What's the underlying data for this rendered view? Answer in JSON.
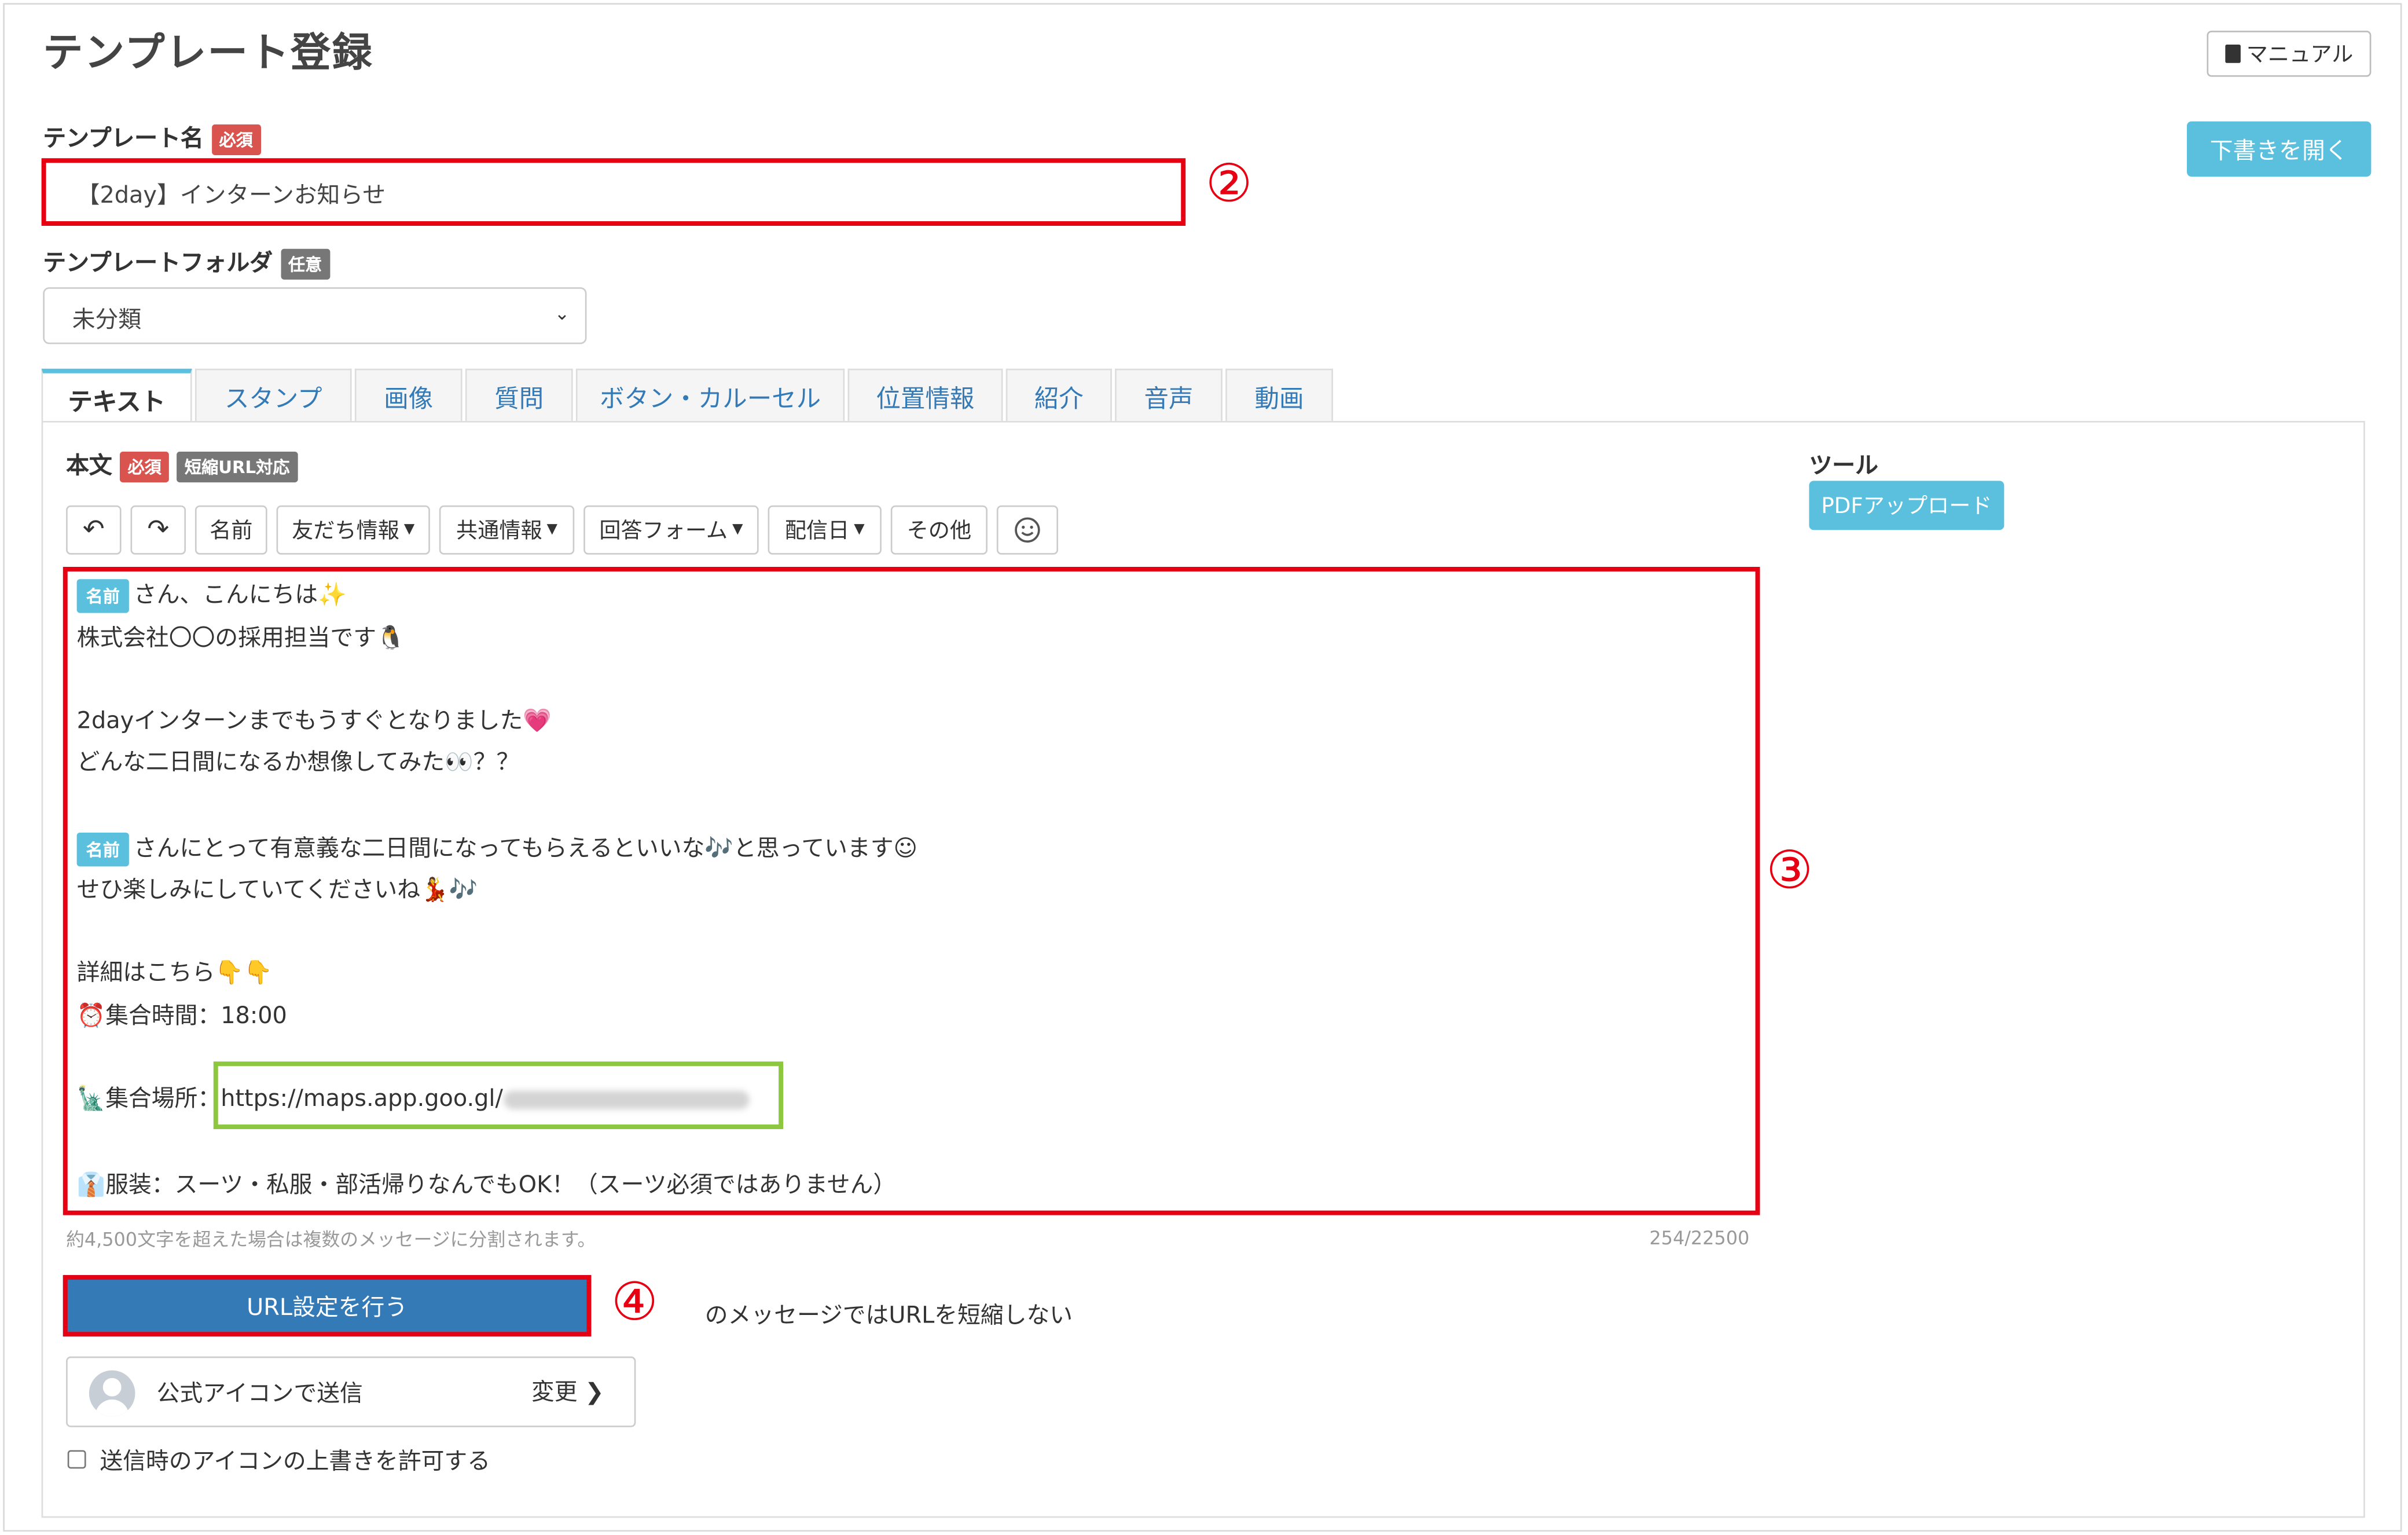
{
  "page": {
    "title": "テンプレート登録"
  },
  "header": {
    "manual_label": "マニュアル",
    "draft_label": "下書きを開く"
  },
  "form": {
    "name_label": "テンプレート名",
    "required_badge": "必須",
    "name_value": "【2day】インターンお知らせ",
    "folder_label": "テンプレートフォルダ",
    "optional_badge": "任意",
    "folder_value": "未分類"
  },
  "markers": {
    "m2": "②",
    "m3": "③",
    "m4": "④"
  },
  "tabs": [
    "テキスト",
    "スタンプ",
    "画像",
    "質問",
    "ボタン・カルーセル",
    "位置情報",
    "紹介",
    "音声",
    "動画"
  ],
  "body_section": {
    "label": "本文",
    "required_badge": "必須",
    "short_url_badge": "短縮URL対応"
  },
  "toolbar": {
    "undo_icon": "undo-icon",
    "redo_icon": "redo-icon",
    "name_label": "名前",
    "friend_info_label": "友だち情報",
    "common_info_label": "共通情報",
    "answer_form_label": "回答フォーム",
    "delivery_date_label": "配信日",
    "other_label": "その他",
    "emoji_icon": "smiley-icon"
  },
  "editor": {
    "name_chip": "名前",
    "line1": "さん、こんにちは✨",
    "line2": "株式会社〇〇の採用担当です🐧",
    "line3": "2dayインターンまでもうすぐとなりました💗",
    "line4": "どんな二日間になるか想像してみた👀？？",
    "line5": "さんにとって有意義な二日間になってもらえるといいな🎶と思っています☺",
    "line6": "せひ楽しみにしていてくださいね💃🎶",
    "line7": "詳細はこちら👇👇",
    "line8": "⏰集合時間：18:00",
    "line9_prefix": "🗽集合場所：",
    "line9_url": "https://maps.app.goo.gl/",
    "line10": "👔服装：スーツ・私服・部活帰りなんでもOK！（スーツ必須ではありません）"
  },
  "hints": {
    "split_notice": "約4,500文字を超えた場合は複数のメッセージに分割されます。",
    "char_count": "254/22500"
  },
  "url_settings": {
    "button_label": "URL設定を行う",
    "note": "のメッセージではURLを短縮しない"
  },
  "icon_setting": {
    "label": "公式アイコンで送信",
    "change_label": "変更"
  },
  "override": {
    "label": "送信時のアイコンの上書きを許可する",
    "checked": false
  },
  "tools": {
    "title": "ツール",
    "pdf_upload_label": "PDFアップロード"
  }
}
